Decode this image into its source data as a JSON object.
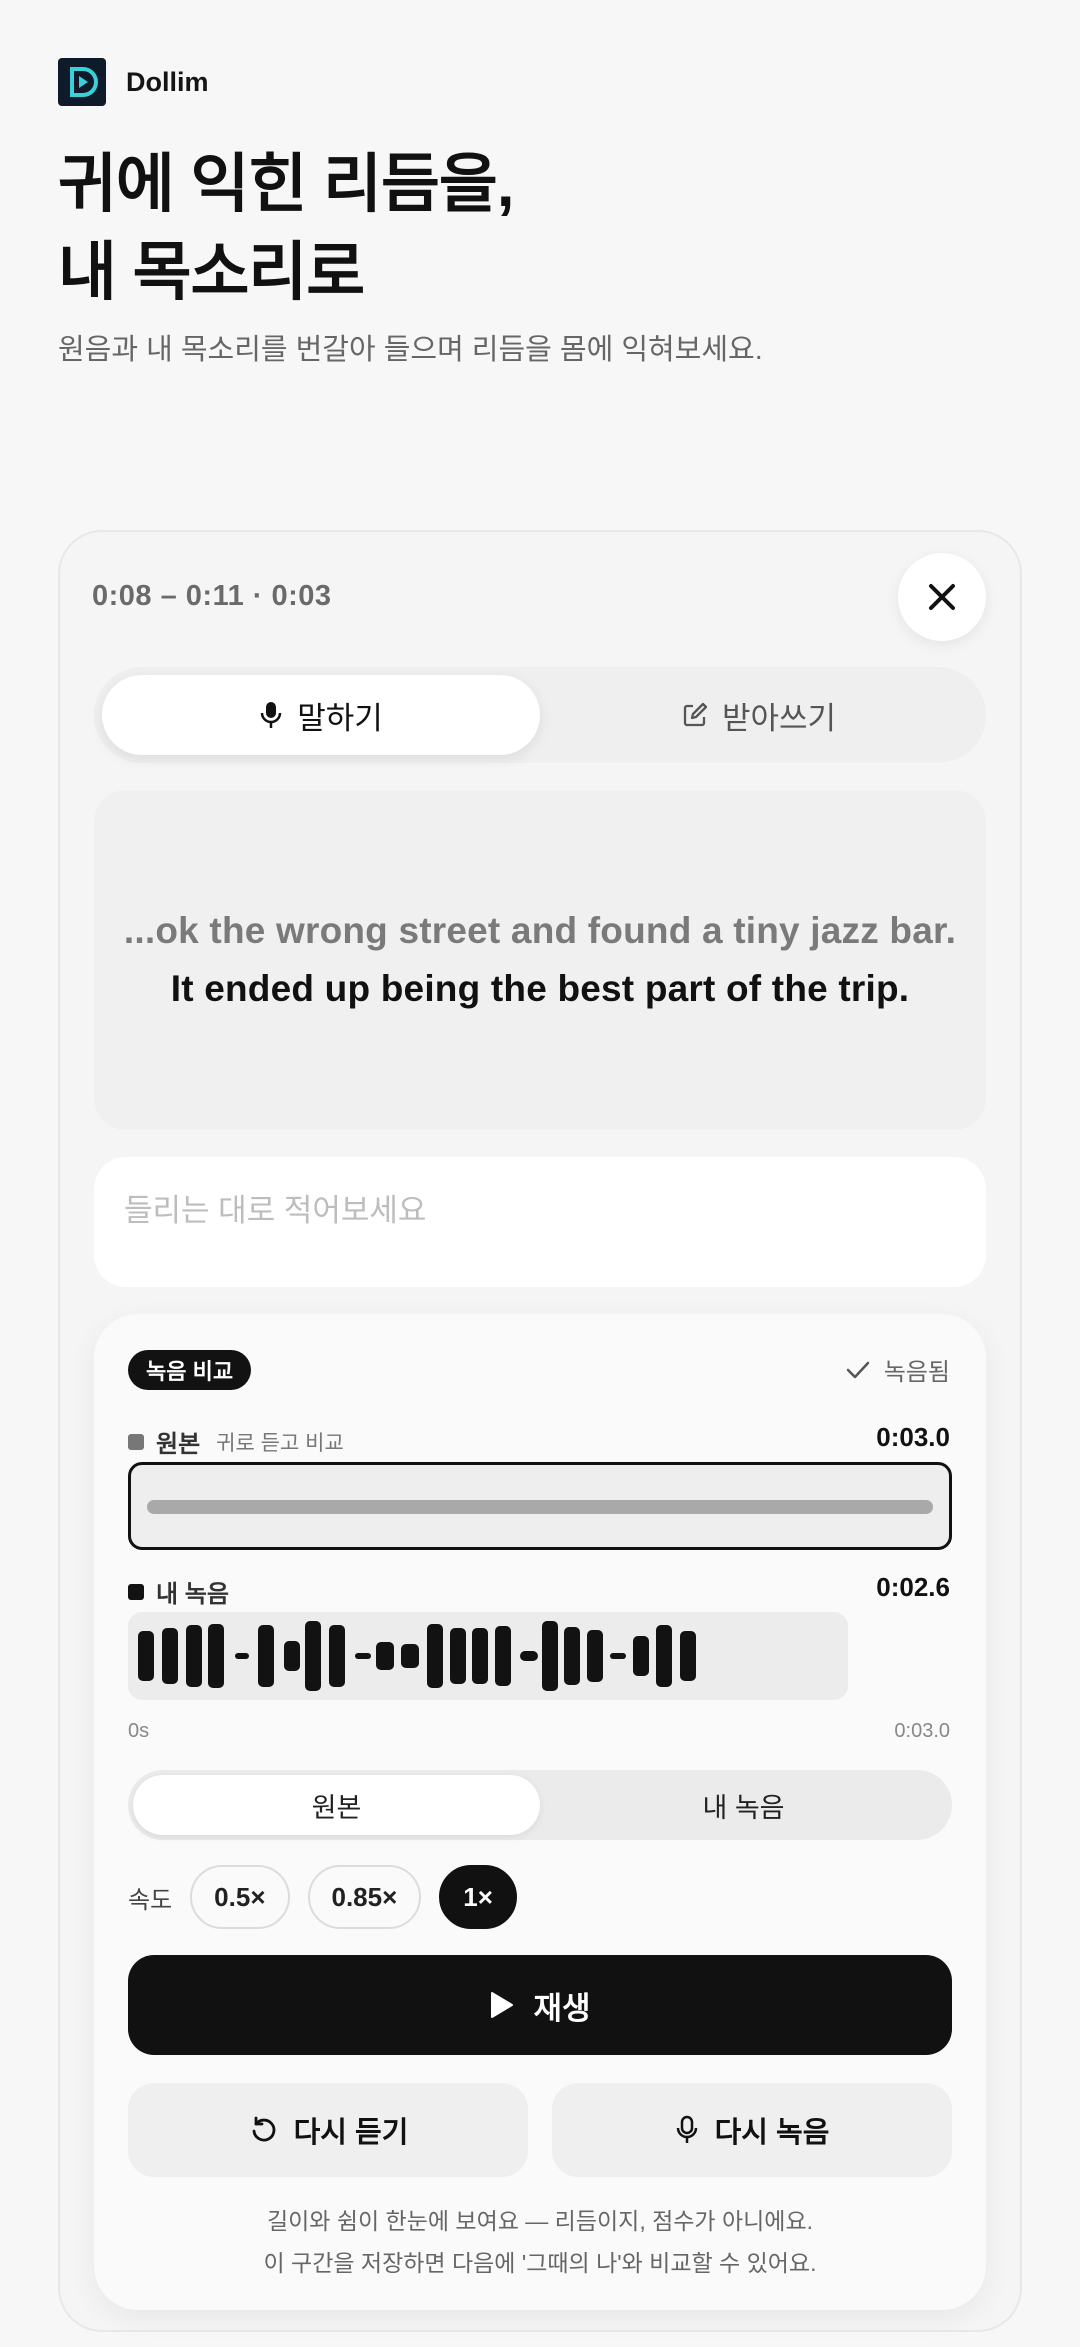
{
  "brand": {
    "name": "Dollim"
  },
  "hero": {
    "title_line1": "귀에 익힌 리듬을,",
    "title_line2": "내 목소리로",
    "subtitle": "원음과 내 목소리를 번갈아 들으며 리듬을 몸에 익혀보세요."
  },
  "panel": {
    "time_range": "0:08 – 0:11 · 0:03",
    "tabs": [
      {
        "label": "말하기",
        "icon": "mic-icon",
        "active": true
      },
      {
        "label": "받아쓰기",
        "icon": "edit-icon",
        "active": false
      }
    ],
    "sentence": {
      "previous": "...ok the wrong street and found a tiny jazz bar.",
      "current": "It ended up being the best part of the trip."
    },
    "dictation_placeholder": "들리는 대로 적어보세요"
  },
  "compare": {
    "badge": "녹음 비교",
    "status": "녹음됨",
    "original": {
      "name": "원본",
      "hint": "귀로 듣고 비교",
      "duration": "0:03.0",
      "color": "#777777"
    },
    "mine": {
      "name": "내 녹음",
      "duration": "0:02.6",
      "color": "#121212"
    },
    "axis_start": "0s",
    "axis_end": "0:03.0",
    "toggle": [
      {
        "label": "원본",
        "active": true
      },
      {
        "label": "내 녹음",
        "active": false
      }
    ],
    "speed": {
      "label": "속도",
      "options": [
        {
          "label": "0.5×",
          "active": false
        },
        {
          "label": "0.85×",
          "active": false
        },
        {
          "label": "1×",
          "active": true
        }
      ]
    },
    "play_label": "재생",
    "relisten_label": "다시 듣기",
    "rerecord_label": "다시 녹음",
    "footnote_line1": "길이와 쉼이 한눈에 보여요 — 리듬이지, 점수가 아니에요.",
    "footnote_line2": "이 구간을 저장하면 다음에 '그때의 나'와 비교할 수 있어요."
  },
  "colors": {
    "accent": "#111111",
    "logo_bg": "#0f1a2a",
    "logo_fg": "#3ad0d8"
  }
}
